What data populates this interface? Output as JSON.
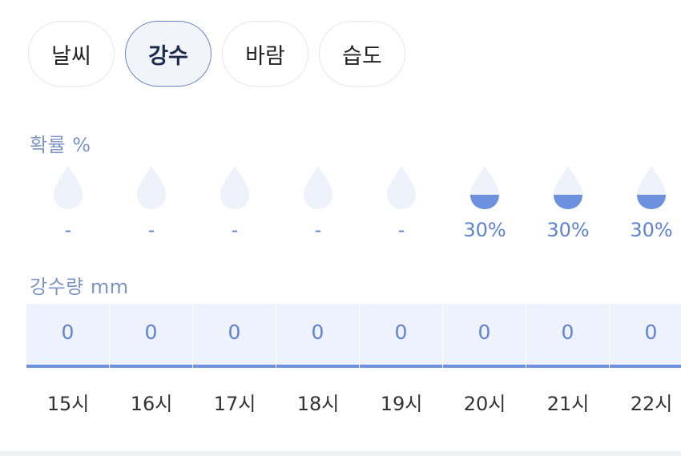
{
  "tabs": [
    {
      "label": "날씨",
      "active": false
    },
    {
      "label": "강수",
      "active": true
    },
    {
      "label": "바람",
      "active": false
    },
    {
      "label": "습도",
      "active": false
    }
  ],
  "probability": {
    "label": "확률 %",
    "items": [
      {
        "text": "-",
        "fill_percent": 0
      },
      {
        "text": "-",
        "fill_percent": 0
      },
      {
        "text": "-",
        "fill_percent": 0
      },
      {
        "text": "-",
        "fill_percent": 0
      },
      {
        "text": "-",
        "fill_percent": 0
      },
      {
        "text": "30%",
        "fill_percent": 30
      },
      {
        "text": "30%",
        "fill_percent": 30
      },
      {
        "text": "30%",
        "fill_percent": 30
      }
    ]
  },
  "precipitation": {
    "label": "강수량 mm",
    "values": [
      "0",
      "0",
      "0",
      "0",
      "0",
      "0",
      "0",
      "0"
    ]
  },
  "hours": [
    "15시",
    "16시",
    "17시",
    "18시",
    "19시",
    "20시",
    "21시",
    "22시"
  ],
  "colors": {
    "accent": "#5f82d1",
    "drop_empty": "#eef2fb",
    "drop_fill": "#6d91de",
    "amount_bg": "#edf2fd"
  }
}
